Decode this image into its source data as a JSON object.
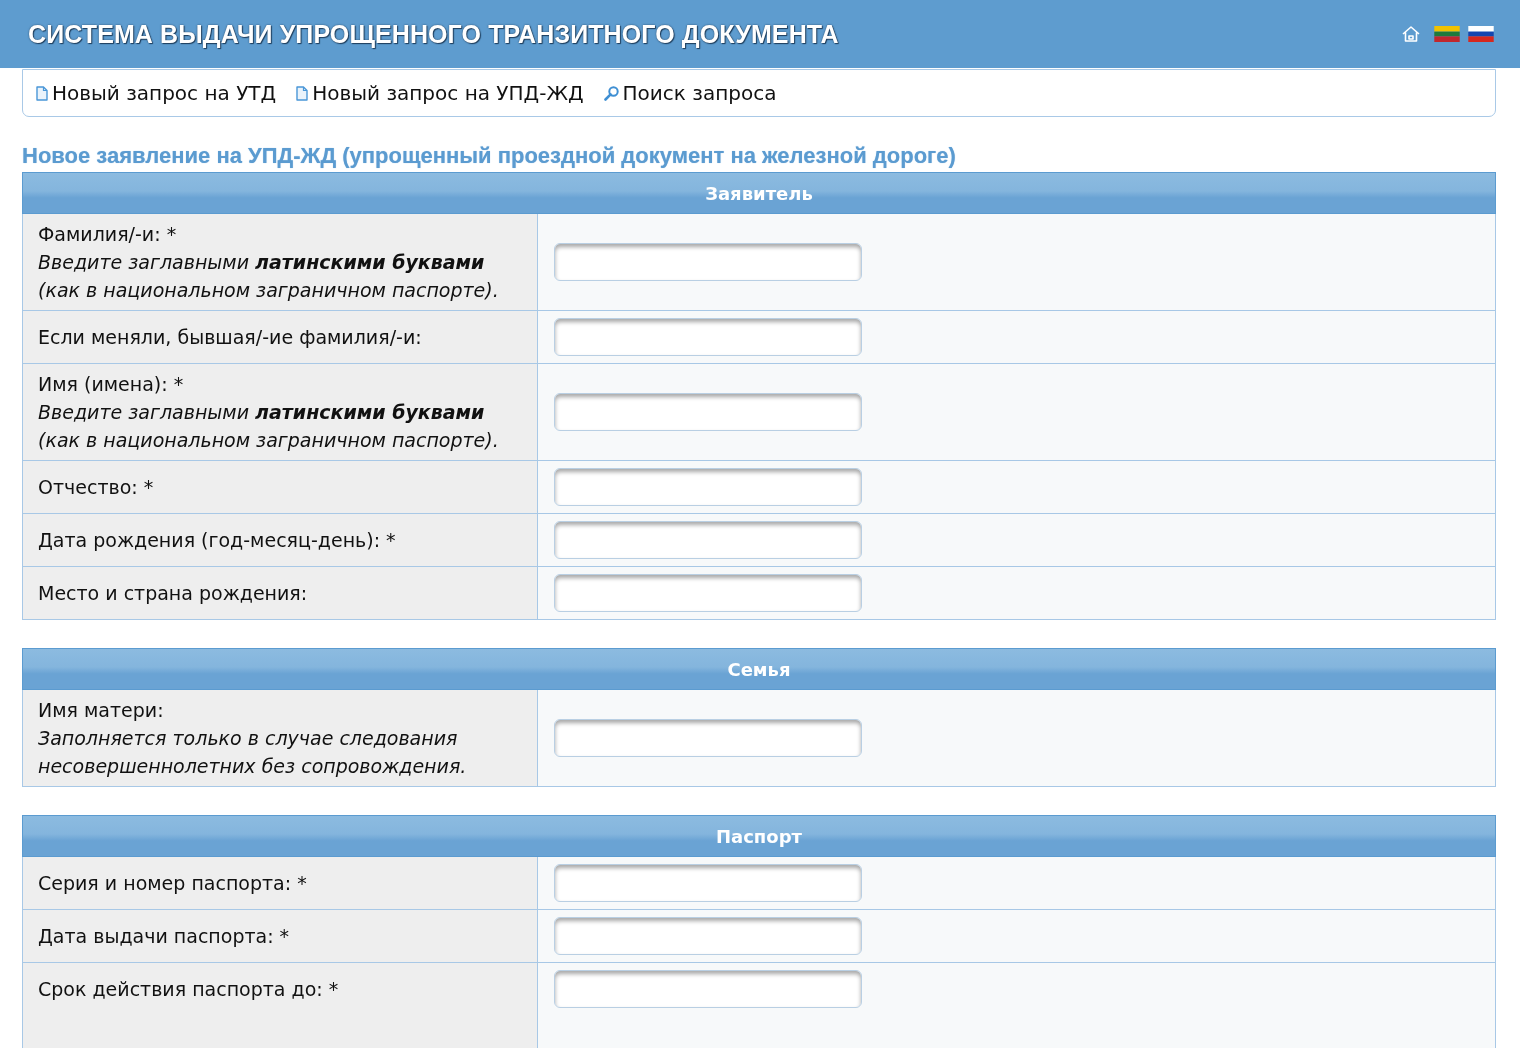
{
  "header": {
    "title": "СИСТЕМА ВЫДАЧИ УПРОЩЕННОГО ТРАНЗИТНОГО ДОКУМЕНТА"
  },
  "nav": [
    {
      "kind": "document",
      "label": "Новый запрос на УТД"
    },
    {
      "kind": "document",
      "label": "Новый запрос на УПД-ЖД"
    },
    {
      "kind": "search",
      "label": "Поиск запроса"
    }
  ],
  "page_title": "Новое заявление на УПД-ЖД (упрощенный проездной документ на железной дороге)",
  "sections": [
    {
      "title": "Заявитель",
      "fields": [
        {
          "label": "Фамилия/-и: *",
          "hint": "Введите заглавными **латинскими буквами** (как в национальном заграничном паспорте)."
        },
        {
          "label": "Если меняли, бывшая/-ие фамилия/-и:"
        },
        {
          "label": "Имя (имена): *",
          "hint": "Введите заглавными **латинскими буквами** (как в национальном заграничном паспорте)."
        },
        {
          "label": "Отчество: *"
        },
        {
          "label": "Дата рождения (год-месяц-день): *"
        },
        {
          "label": "Место и страна рождения:"
        }
      ]
    },
    {
      "title": "Семья",
      "fields": [
        {
          "label": "Имя матери:",
          "hint": "Заполняется только в случае следования несовершеннолетних без сопровождения."
        }
      ]
    },
    {
      "title": "Паспорт",
      "fields": [
        {
          "label": "Серия и номер паспорта: *"
        },
        {
          "label": "Дата выдачи паспорта: *"
        },
        {
          "label": "Срок действия паспорта до: *"
        }
      ]
    }
  ]
}
